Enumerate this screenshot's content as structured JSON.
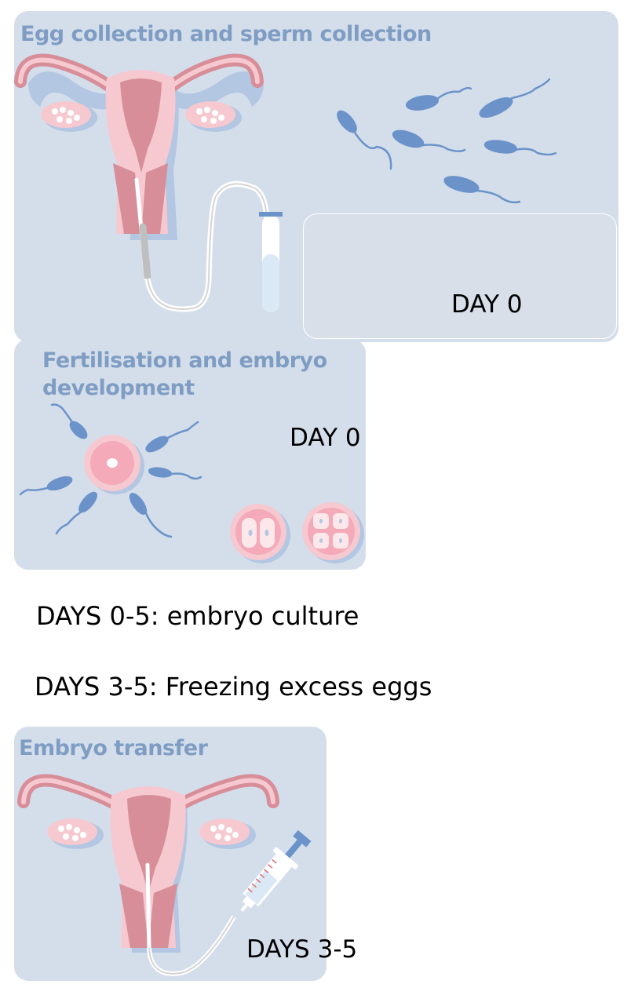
{
  "steps": [
    {
      "title": "Egg collection and sperm collection",
      "day": "DAY 0"
    },
    {
      "title_line1": "Fertilisation and embryo",
      "title_line2": "development",
      "day": "DAY 0"
    },
    {
      "title": "Embryo transfer",
      "day": "DAYS 3-5"
    }
  ],
  "labels": {
    "embryo_culture": "DAYS 0-5: embryo culture",
    "freezing": "DAYS 3-5: Freezing excess eggs"
  },
  "colors": {
    "panel": "#d4deeb",
    "title": "#7f9dc3",
    "uterus_dark": "#d78e98",
    "uterus_light": "#f6c9d0",
    "sperm": "#6b93c9"
  },
  "icons": [
    "uterus-icon",
    "catheter-icon",
    "test-tube-icon",
    "sperm-icon",
    "egg-icon",
    "embryo-2cell-icon",
    "embryo-4cell-icon",
    "syringe-icon"
  ]
}
